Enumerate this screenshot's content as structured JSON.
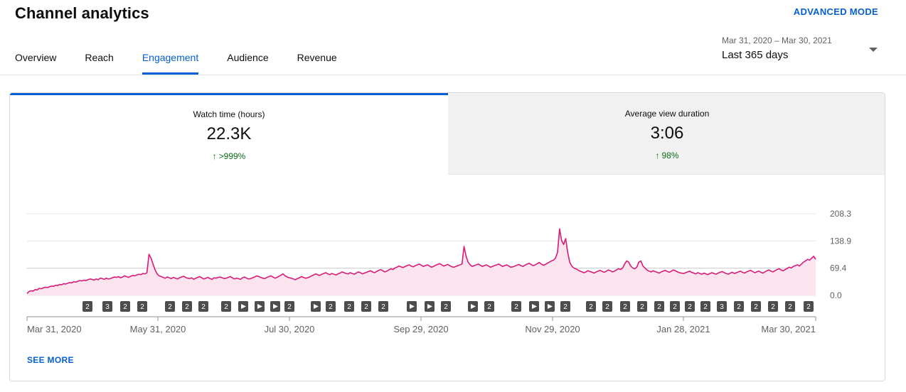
{
  "header": {
    "title": "Channel analytics",
    "advanced_mode": "ADVANCED MODE"
  },
  "tabs": [
    {
      "label": "Overview"
    },
    {
      "label": "Reach"
    },
    {
      "label": "Engagement",
      "active": true
    },
    {
      "label": "Audience"
    },
    {
      "label": "Revenue"
    }
  ],
  "date_picker": {
    "range": "Mar 31, 2020 – Mar 30, 2021",
    "label": "Last 365 days",
    "icon": "chevron-down-icon"
  },
  "metrics": [
    {
      "title": "Watch time (hours)",
      "value": "22.3K",
      "change": ">999%",
      "direction": "up",
      "selected": true
    },
    {
      "title": "Average view duration",
      "value": "3:06",
      "change": "98%",
      "direction": "up",
      "selected": false
    }
  ],
  "colors": {
    "accent": "#065fd4",
    "line": "#d81b77",
    "area": "#fce4ef",
    "positive": "#0b6e19"
  },
  "see_more": "SEE MORE",
  "chart_data": {
    "type": "area",
    "series_name": "Watch time (hours)",
    "ylim": [
      0,
      208.3
    ],
    "y_ticks": [
      "208.3",
      "138.9",
      "69.4",
      "0.0"
    ],
    "x_ticks": [
      "Mar 31, 2020",
      "May 31, 2020",
      "Jul 30, 2020",
      "Sep 29, 2020",
      "Nov 29, 2020",
      "Jan 28, 2021",
      "Mar 30, 2021"
    ],
    "reference_line": 69.4,
    "x_start": "2020-03-31",
    "days": 365,
    "values": [
      5,
      10,
      12,
      11,
      15,
      14,
      18,
      17,
      19,
      21,
      20,
      22,
      24,
      23,
      26,
      25,
      28,
      27,
      30,
      29,
      31,
      33,
      32,
      35,
      34,
      36,
      38,
      37,
      39,
      38,
      40,
      42,
      41,
      39,
      42,
      40,
      44,
      43,
      41,
      44,
      42,
      43,
      45,
      47,
      46,
      48,
      45,
      47,
      50,
      48,
      46,
      49,
      51,
      50,
      52,
      54,
      53,
      56,
      55,
      58,
      105,
      95,
      80,
      65,
      55,
      50,
      48,
      46,
      44,
      47,
      45,
      43,
      46,
      44,
      42,
      45,
      47,
      49,
      46,
      44,
      43,
      45,
      41,
      44,
      46,
      48,
      45,
      42,
      44,
      46,
      43,
      41,
      45,
      44,
      46,
      47,
      45,
      43,
      44,
      46,
      48,
      45,
      42,
      44,
      43,
      41,
      45,
      47,
      44,
      42,
      43,
      45,
      47,
      50,
      48,
      46,
      44,
      43,
      46,
      48,
      50,
      47,
      44,
      46,
      49,
      52,
      55,
      50,
      47,
      45,
      44,
      42,
      40,
      43,
      45,
      48,
      46,
      44,
      45,
      47,
      50,
      52,
      55,
      53,
      51,
      54,
      56,
      58,
      55,
      53,
      56,
      54,
      52,
      55,
      57,
      60,
      58,
      56,
      55,
      58,
      56,
      54,
      57,
      60,
      58,
      55,
      57,
      59,
      61,
      63,
      60,
      58,
      61,
      64,
      66,
      63,
      60,
      62,
      65,
      68,
      66,
      70,
      72,
      75,
      73,
      71,
      74,
      76,
      78,
      75,
      73,
      76,
      78,
      80,
      77,
      74,
      76,
      78,
      75,
      72,
      74,
      77,
      79,
      81,
      78,
      75,
      77,
      79,
      76,
      73,
      72,
      74,
      76,
      78,
      80,
      125,
      100,
      85,
      78,
      74,
      76,
      78,
      80,
      77,
      74,
      76,
      78,
      75,
      72,
      74,
      76,
      78,
      80,
      77,
      74,
      76,
      78,
      75,
      72,
      73,
      75,
      77,
      79,
      76,
      74,
      77,
      80,
      82,
      79,
      76,
      78,
      81,
      84,
      80,
      77,
      79,
      82,
      85,
      88,
      90,
      95,
      110,
      170,
      140,
      130,
      145,
      110,
      85,
      75,
      70,
      68,
      65,
      62,
      60,
      58,
      60,
      63,
      61,
      59,
      57,
      60,
      62,
      64,
      61,
      59,
      62,
      65,
      63,
      60,
      62,
      65,
      68,
      66,
      70,
      80,
      88,
      85,
      75,
      70,
      68,
      72,
      85,
      88,
      75,
      70,
      65,
      62,
      60,
      63,
      61,
      59,
      57,
      60,
      62,
      64,
      61,
      59,
      62,
      65,
      63,
      60,
      58,
      57,
      56,
      58,
      60,
      62,
      59,
      57,
      55,
      58,
      56,
      54,
      57,
      55,
      53,
      56,
      58,
      56,
      54,
      57,
      59,
      61,
      58,
      56,
      54,
      57,
      59,
      56,
      58,
      60,
      62,
      59,
      57,
      60,
      62,
      64,
      61,
      58,
      60,
      62,
      59,
      57,
      60,
      63,
      65,
      62,
      60,
      63,
      66,
      68,
      65,
      63,
      66,
      69,
      72,
      70,
      74,
      76,
      78,
      75,
      80,
      85,
      88,
      92,
      90,
      95,
      100,
      92
    ]
  },
  "annotations": [
    {
      "label": "2"
    },
    {
      "label": "3"
    },
    {
      "label": "2"
    },
    {
      "label": "2"
    },
    {
      "label": "2"
    },
    {
      "label": "2"
    },
    {
      "label": "2"
    },
    {
      "label": "2"
    },
    {
      "label": "▶"
    },
    {
      "label": "▶"
    },
    {
      "label": "▶"
    },
    {
      "label": "2"
    },
    {
      "label": "▶"
    },
    {
      "label": "2"
    },
    {
      "label": "2"
    },
    {
      "label": "2"
    },
    {
      "label": "2"
    },
    {
      "label": "▶"
    },
    {
      "label": "▶"
    },
    {
      "label": "2"
    },
    {
      "label": "▶"
    },
    {
      "label": "2"
    },
    {
      "label": "2"
    },
    {
      "label": "▶"
    },
    {
      "label": "▶"
    },
    {
      "label": "2"
    },
    {
      "label": "2"
    },
    {
      "label": "2"
    },
    {
      "label": "2"
    },
    {
      "label": "2"
    },
    {
      "label": "2"
    },
    {
      "label": "2"
    },
    {
      "label": "2"
    },
    {
      "label": "2"
    },
    {
      "label": "3"
    },
    {
      "label": "2"
    },
    {
      "label": "2"
    },
    {
      "label": "2"
    },
    {
      "label": "2"
    },
    {
      "label": "2"
    },
    {
      "label": "2"
    }
  ]
}
